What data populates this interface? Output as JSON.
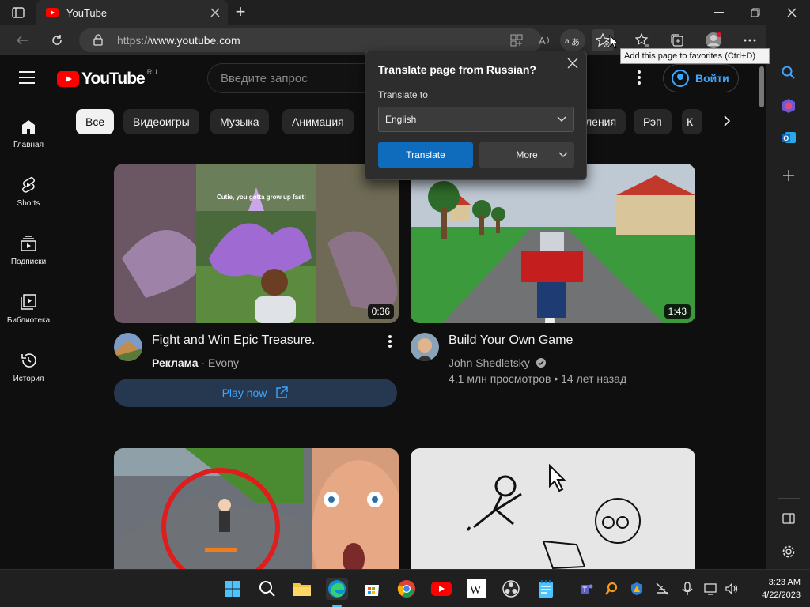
{
  "browser": {
    "tab_title": "YouTube",
    "url_prefix": "https://",
    "url_host": "www.youtube.com",
    "tooltip": "Add this page to favorites (Ctrl+D)"
  },
  "translate_popup": {
    "title": "Translate page from Russian?",
    "label": "Translate to",
    "selected_language": "English",
    "translate_button": "Translate",
    "more_button": "More"
  },
  "youtube": {
    "logo_text": "YouTube",
    "country_code": "RU",
    "search_placeholder": "Введите запрос",
    "signin_label": "Войти",
    "guide": [
      {
        "label": "Главная",
        "icon": "home-icon"
      },
      {
        "label": "Shorts",
        "icon": "shorts-icon"
      },
      {
        "label": "Подписки",
        "icon": "subscriptions-icon"
      },
      {
        "label": "Библиотека",
        "icon": "library-icon"
      },
      {
        "label": "История",
        "icon": "history-icon"
      }
    ],
    "chips": [
      "Все",
      "Видеоигры",
      "Музыка",
      "Анимация",
      "ления",
      "Рэп",
      "К"
    ],
    "videos": [
      {
        "title": "Fight and Win Epic Treasure.",
        "ad_label": "Реклама",
        "channel": "Evony",
        "duration": "0:36",
        "cta": "Play now",
        "thumb_caption": "Cutie, you gotta grow up fast!"
      },
      {
        "title": "Build Your Own Game",
        "channel": "John Shedletsky",
        "stats": "4,1 млн просмотров • 14 лет назад",
        "duration": "1:43"
      }
    ]
  },
  "taskbar": {
    "time": "3:23 AM",
    "date": "4/22/2023"
  },
  "colors": {
    "youtube_red": "#ff0000",
    "link_blue": "#3ea6ff",
    "edge_blue": "#0f6cbd",
    "bg": "#0f0f0f"
  }
}
